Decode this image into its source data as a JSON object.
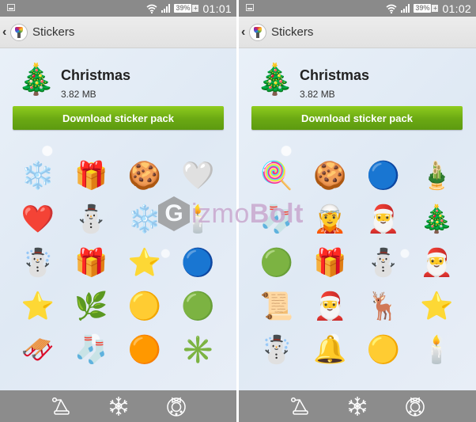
{
  "screens": [
    {
      "status": {
        "time": "01:01",
        "battery": "39%",
        "battery_plus": "+"
      },
      "header": {
        "back": "‹",
        "title": "Stickers"
      },
      "pack": {
        "thumb": "🎄",
        "name": "Christmas",
        "size": "3.82 MB",
        "download_label": "Download sticker pack"
      },
      "stickers": [
        {
          "name": "snowflake",
          "glyph": "❄️"
        },
        {
          "name": "pink-gift",
          "glyph": "🎁"
        },
        {
          "name": "gingerbread-cookie",
          "glyph": "🍪"
        },
        {
          "name": "white-heart",
          "glyph": "🤍"
        },
        {
          "name": "red-heart",
          "glyph": "❤️"
        },
        {
          "name": "snowman-teal",
          "glyph": "⛄"
        },
        {
          "name": "snowflake-silver",
          "glyph": "❄️"
        },
        {
          "name": "red-candle",
          "glyph": "🕯️"
        },
        {
          "name": "snowman",
          "glyph": "☃️"
        },
        {
          "name": "green-gift",
          "glyph": "🎁"
        },
        {
          "name": "hanging-blue-star",
          "glyph": "⭐"
        },
        {
          "name": "blue-ornament",
          "glyph": "🔵"
        },
        {
          "name": "gold-star",
          "glyph": "⭐"
        },
        {
          "name": "holly",
          "glyph": "🌿"
        },
        {
          "name": "gold-ornament",
          "glyph": "🟡"
        },
        {
          "name": "green-ornament",
          "glyph": "🟢"
        },
        {
          "name": "santa-sleigh",
          "glyph": "🛷"
        },
        {
          "name": "striped-stocking",
          "glyph": "🧦"
        },
        {
          "name": "orange-ornament",
          "glyph": "🟠"
        },
        {
          "name": "hanging-green-star",
          "glyph": "✳️"
        }
      ]
    },
    {
      "status": {
        "time": "01:02",
        "battery": "39%",
        "battery_plus": "+"
      },
      "header": {
        "back": "‹",
        "title": "Stickers"
      },
      "pack": {
        "thumb": "🎄",
        "name": "Christmas",
        "size": "3.82 MB",
        "download_label": "Download sticker pack"
      },
      "stickers": [
        {
          "name": "candy-cane",
          "glyph": "🍭"
        },
        {
          "name": "gingerbread-man",
          "glyph": "🍪"
        },
        {
          "name": "blue-star-ornament",
          "glyph": "🔵"
        },
        {
          "name": "bell-garland",
          "glyph": "🎍"
        },
        {
          "name": "red-stocking",
          "glyph": "🧦"
        },
        {
          "name": "elf",
          "glyph": "🧝"
        },
        {
          "name": "santa-bell",
          "glyph": "🎅"
        },
        {
          "name": "christmas-tree",
          "glyph": "🎄"
        },
        {
          "name": "green-ornament",
          "glyph": "🟢"
        },
        {
          "name": "blue-gift",
          "glyph": "🎁"
        },
        {
          "name": "snowman-scarf",
          "glyph": "⛄"
        },
        {
          "name": "santa-hat",
          "glyph": "🎅"
        },
        {
          "name": "santa-list",
          "glyph": "📜"
        },
        {
          "name": "santa-sack",
          "glyph": "🎅"
        },
        {
          "name": "reindeer",
          "glyph": "🦌"
        },
        {
          "name": "red-star",
          "glyph": "⭐"
        },
        {
          "name": "snowman-hat",
          "glyph": "☃️"
        },
        {
          "name": "gold-bell",
          "glyph": "🔔"
        },
        {
          "name": "gold-ornament",
          "glyph": "🟡"
        },
        {
          "name": "candle",
          "glyph": "🕯️"
        }
      ]
    }
  ],
  "bottom_tabs": [
    {
      "name": "santa-hat-tab",
      "icon": "santa-hat-icon"
    },
    {
      "name": "snowflake-tab",
      "icon": "snowflake-icon"
    },
    {
      "name": "wreath-tab",
      "icon": "wreath-icon"
    }
  ],
  "watermark": {
    "letter": "G",
    "text_light": "izmo",
    "text_bold": "Bolt"
  }
}
